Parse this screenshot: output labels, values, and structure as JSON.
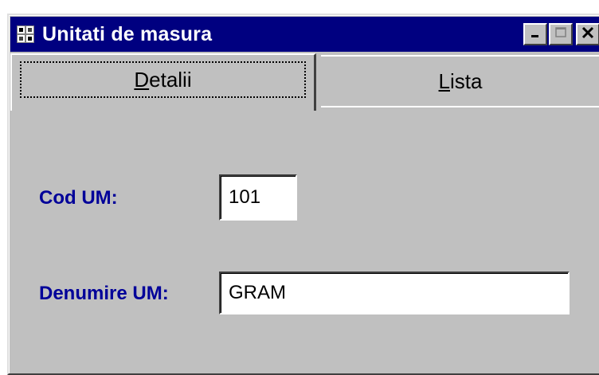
{
  "window": {
    "title": "Unitati de masura",
    "icon": "grid-app-icon",
    "caption_buttons": [
      "minimize",
      "maximize",
      "close"
    ]
  },
  "tabs": [
    {
      "label": "Detalii",
      "mnemonic": "D",
      "rest": "etalii",
      "active": true
    },
    {
      "label": "Lista",
      "mnemonic": "L",
      "rest": "ista",
      "active": false
    }
  ],
  "form": {
    "cod_label": "Cod UM:",
    "cod_value": "101",
    "denumire_label": "Denumire UM:",
    "denumire_value": "GRAM"
  },
  "colors": {
    "titlebar": "#000080",
    "face": "#c0c0c0",
    "label": "#000099"
  }
}
